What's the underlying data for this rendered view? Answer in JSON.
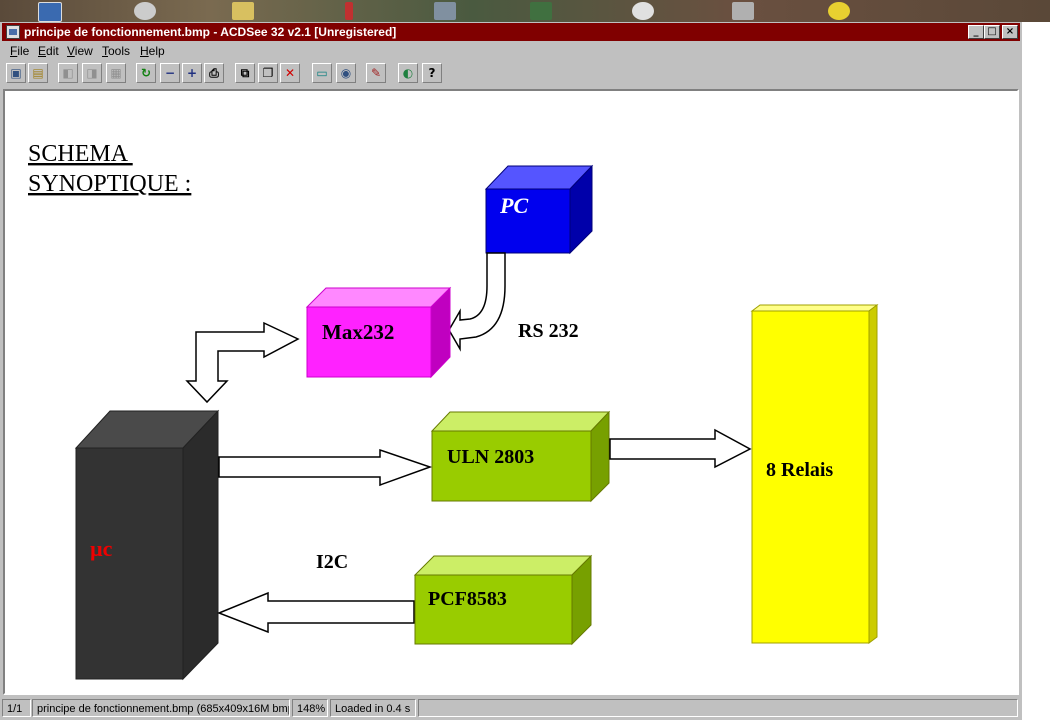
{
  "window": {
    "title": "principe de fonctionnement.bmp - ACDSee 32 v2.1  [Unregistered]",
    "controls": [
      "_",
      "□",
      "×"
    ]
  },
  "menu": [
    {
      "key": "F",
      "rest": "ile"
    },
    {
      "key": "E",
      "rest": "dit"
    },
    {
      "key": "V",
      "rest": "iew"
    },
    {
      "key": "T",
      "rest": "ools"
    },
    {
      "key": "H",
      "rest": "elp"
    }
  ],
  "toolbar_glyphs": {
    "browse": "▣",
    "open": "▤",
    "prev": "◧",
    "next": "◨",
    "fullscreen": "▦",
    "rotate": "↻",
    "zoom_out": "−",
    "zoom_in": "+",
    "print": "⎙",
    "copy": "⧉",
    "paste": "❐",
    "delete": "✕",
    "slideshow": "▭",
    "wallpaper": "◉",
    "tools": "✎",
    "view": "◐",
    "help": "?"
  },
  "diagram": {
    "heading_line1": "SCHEMA ",
    "heading_line2": "SYNOPTIQUE :",
    "pc": "PC",
    "max232": "Max232",
    "rs232": "RS 232",
    "uc": "µc",
    "uln": "ULN 2803",
    "relais": "8 Relais",
    "i2c": "I2C",
    "pcf": "PCF8583",
    "colors": {
      "pc": "#0000ee",
      "max232": "#ff22ff",
      "uc": "#333333",
      "uc_label": "#ee0000",
      "green": "#99cc00",
      "relais": "#ffff00",
      "titlebar": "#800000"
    }
  },
  "status": {
    "index": "1/1",
    "file": "principe de fonctionnement.bmp (685x409x16M bmp)",
    "zoom": "148%",
    "load": "Loaded in 0.4 s"
  }
}
